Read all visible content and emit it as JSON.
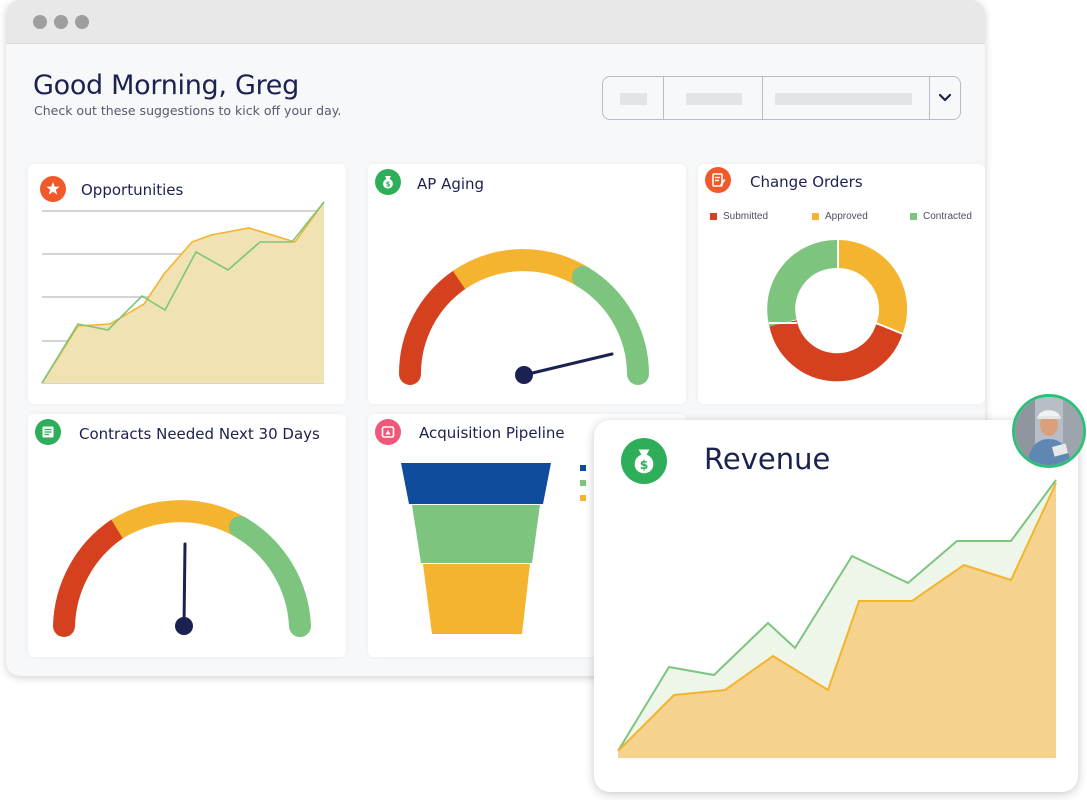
{
  "header": {
    "greeting": "Good Morning, Greg",
    "subtitle": "Check out these suggestions to kick off your day."
  },
  "colors": {
    "navy": "#1b2150",
    "red": "#d5411f",
    "orange": "#f5b42f",
    "green": "#7dc47f",
    "blue": "#0f4c9b",
    "tan_fill": "#f1e2b3"
  },
  "cards": {
    "opportunities": {
      "title": "Opportunities",
      "icon": "star-person-icon"
    },
    "ap_aging": {
      "title": "AP Aging",
      "icon": "money-bag-icon"
    },
    "change_orders": {
      "title": "Change Orders",
      "icon": "document-edit-icon",
      "legend": [
        "Submitted",
        "Approved",
        "Contracted"
      ]
    },
    "contracts": {
      "title": "Contracts Needed Next 30 Days",
      "icon": "contract-icon"
    },
    "pipeline": {
      "title": "Acquisition Pipeline",
      "icon": "pipeline-icon"
    }
  },
  "revenue": {
    "title": "Revenue",
    "icon": "money-bag-icon"
  }
}
